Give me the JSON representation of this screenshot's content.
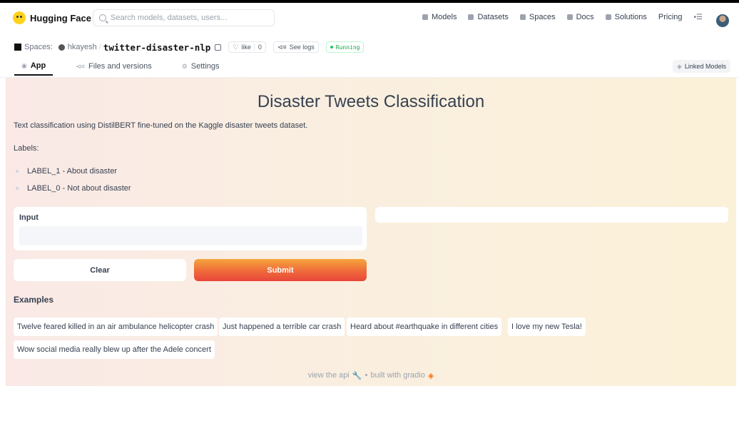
{
  "site": {
    "brand": "Hugging Face",
    "search_placeholder": "Search models, datasets, users...",
    "nav": [
      "Models",
      "Datasets",
      "Spaces",
      "Docs",
      "Solutions",
      "Pricing"
    ]
  },
  "space": {
    "section": "Spaces:",
    "owner": "hkayesh",
    "separator": "/",
    "repo": "twitter-disaster-nlp",
    "like_label": "like",
    "like_count": "0",
    "logs_label": "See logs",
    "status": "Running",
    "tabs": [
      "App",
      "Files and versions",
      "Settings"
    ],
    "linked_models": "Linked Models"
  },
  "app": {
    "title": "Disaster Tweets Classification",
    "description": "Text classification using DistilBERT fine-tuned on the Kaggle disaster tweets dataset.",
    "labels_title": "Labels:",
    "labels": [
      "LABEL_1 - About disaster",
      "LABEL_0 - Not about disaster"
    ],
    "input_label": "Input",
    "input_value": "",
    "clear_label": "Clear",
    "submit_label": "Submit",
    "examples_title": "Examples",
    "examples": [
      "Twelve feared killed in an air ambulance helicopter crash",
      "Just happened a terrible car crash",
      "Heard about #earthquake in different cities",
      "I love my new Tesla!",
      "Wow social media really blew up after the Adele concert"
    ],
    "footer_api": "view the api",
    "footer_sep": "•",
    "footer_built": "built with gradio"
  },
  "colors": {
    "submit_gradient": [
      "#f5a53c",
      "#e8463a"
    ],
    "status_green": "#16a34a",
    "app_background": "#faefdf"
  }
}
